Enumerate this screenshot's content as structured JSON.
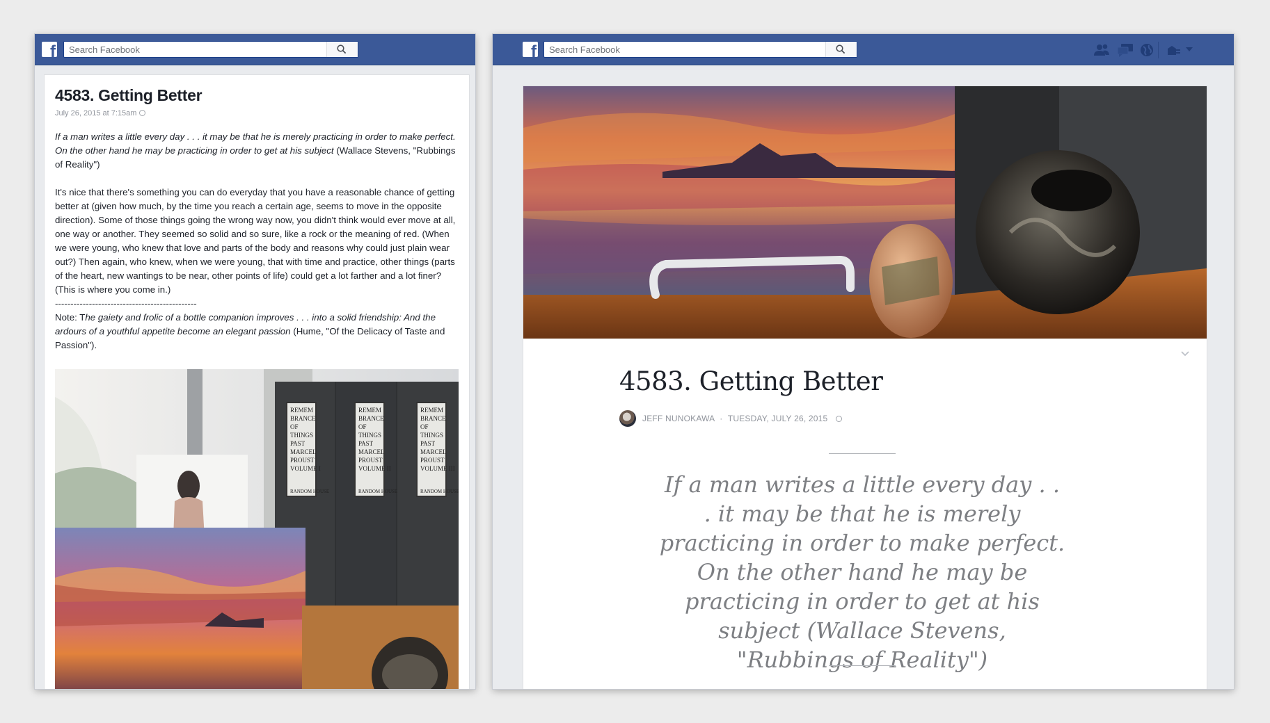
{
  "facebook": {
    "search_placeholder": "Search Facebook"
  },
  "left_post": {
    "title": "4583. Getting Better",
    "timestamp": "July 26, 2015 at 7:15am",
    "epigraph_italic": "If a man writes a little every day . . .  it may be that he is merely practicing in order to make perfect. On the other hand he may be practicing in order to get at his subject",
    "epigraph_source": " (Wallace Stevens, \"Rubbings of Reality\")",
    "body": "It's nice that there's something you can do everyday that you have a reasonable chance of getting better at (given how much, by the time you reach a certain age, seems to move in the opposite direction). Some of those things going the wrong way now, you didn't think would ever move at all, one way or another. They seemed so solid and so sure, like a rock or the meaning of red. (When we were young, who knew that love and parts of the body and reasons why could just plain wear out?) Then again, who knew, when we were young, that with time and practice, other things (parts of the heart, new wantings to be near, other points of life) could get a lot farther and a lot finer?",
    "body_end": "(This is where you come in.)",
    "divider": "----------------------------------------------",
    "note_prefix": "Note: T",
    "note_italic": "he gaiety and frolic of a bottle companion improves . . .  into a solid friendship: And the ardours of a youthful appetite become an elegant passion",
    "note_source": " (Hume, \"Of the Delicacy of Taste and Passion\").",
    "book_spine": {
      "title_lines": [
        "REMEM",
        "BRANCE",
        "OF",
        "THINGS",
        "PAST"
      ],
      "author_lines": [
        "MARCEL",
        "PROUST"
      ],
      "volumes": [
        "VOLUME I",
        "VOLUME II",
        "VOLUME III"
      ],
      "publisher": "RANDOM HOUSE"
    }
  },
  "right_article": {
    "title": "4583. Getting Better",
    "author": "JEFF NUNOKAWA",
    "separator": "·",
    "date": "TUESDAY, JULY 26, 2015",
    "pull_quote": "If a man writes a little every day . . .  it may be that he is merely practicing in order to make perfect. On the other hand he may be practicing in order to get at his subject (Wallace Stevens, \"Rubbings of Reality\")"
  },
  "colors": {
    "facebook_blue": "#3b5998",
    "page_background": "#e9ebee",
    "quote_gray": "#7d7f83"
  },
  "icons": [
    "facebook-logo-icon",
    "search-icon",
    "globe-icon",
    "friends-icon",
    "messages-icon",
    "notifications-globe-icon",
    "privacy-shortcuts-icon",
    "dropdown-arrow-icon",
    "chevron-down-icon"
  ]
}
